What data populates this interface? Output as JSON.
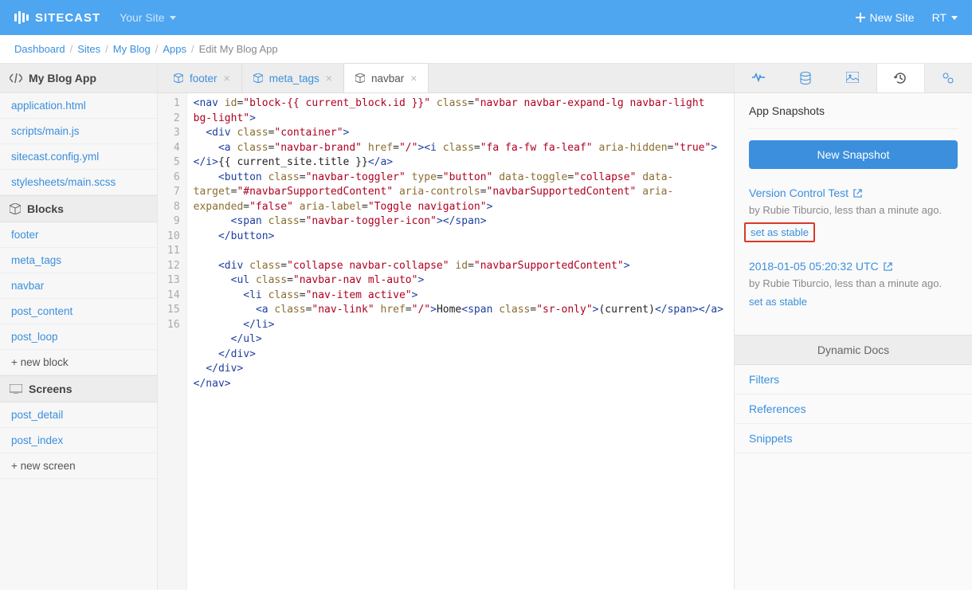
{
  "brand": "SITECAST",
  "site_selector": "Your Site",
  "topbar": {
    "new_site": "New Site",
    "user": "RT"
  },
  "breadcrumbs": [
    "Dashboard",
    "Sites",
    "My Blog",
    "Apps",
    "Edit My Blog App"
  ],
  "sidebar": {
    "app_title": "My Blog App",
    "files": [
      "application.html",
      "scripts/main.js",
      "sitecast.config.yml",
      "stylesheets/main.scss"
    ],
    "blocks_title": "Blocks",
    "blocks": [
      "footer",
      "meta_tags",
      "navbar",
      "post_content",
      "post_loop"
    ],
    "new_block": "+ new block",
    "screens_title": "Screens",
    "screens": [
      "post_detail",
      "post_index"
    ],
    "new_screen": "+ new screen"
  },
  "tabs": [
    {
      "label": "footer",
      "active": false
    },
    {
      "label": "meta_tags",
      "active": false
    },
    {
      "label": "navbar",
      "active": true
    }
  ],
  "code_lines": [
    1,
    2,
    3,
    4,
    5,
    6,
    7,
    8,
    9,
    10,
    11,
    12,
    13,
    14,
    15,
    16
  ],
  "code_html": "<span class='t-tag'>&lt;nav</span> <span class='t-attr'>id</span>=<span class='t-str'>\"block-{{ current_block.id }}\"</span> <span class='t-attr'>class</span>=<span class='t-str'>\"navbar navbar-expand-lg navbar-light bg-light\"</span><span class='t-tag'>&gt;</span>\n  <span class='t-tag'>&lt;div</span> <span class='t-attr'>class</span>=<span class='t-str'>\"container\"</span><span class='t-tag'>&gt;</span>\n    <span class='t-tag'>&lt;a</span> <span class='t-attr'>class</span>=<span class='t-str'>\"navbar-brand\"</span> <span class='t-attr'>href</span>=<span class='t-str'>\"/\"</span><span class='t-tag'>&gt;&lt;i</span> <span class='t-attr'>class</span>=<span class='t-str'>\"fa fa-fw fa-leaf\"</span> <span class='t-attr'>aria-hidden</span>=<span class='t-str'>\"true\"</span><span class='t-tag'>&gt;&lt;/i&gt;</span><span class='t-txt'>{{ current_site.title }}</span><span class='t-tag'>&lt;/a&gt;</span>\n    <span class='t-tag'>&lt;button</span> <span class='t-attr'>class</span>=<span class='t-str'>\"navbar-toggler\"</span> <span class='t-attr'>type</span>=<span class='t-str'>\"button\"</span> <span class='t-attr'>data-toggle</span>=<span class='t-str'>\"collapse\"</span> <span class='t-attr'>data-target</span>=<span class='t-str'>\"#navbarSupportedContent\"</span> <span class='t-attr'>aria-controls</span>=<span class='t-str'>\"navbarSupportedContent\"</span> <span class='t-attr'>aria-expanded</span>=<span class='t-str'>\"false\"</span> <span class='t-attr'>aria-label</span>=<span class='t-str'>\"Toggle navigation\"</span><span class='t-tag'>&gt;</span>\n      <span class='t-tag'>&lt;span</span> <span class='t-attr'>class</span>=<span class='t-str'>\"navbar-toggler-icon\"</span><span class='t-tag'>&gt;&lt;/span&gt;</span>\n    <span class='t-tag'>&lt;/button&gt;</span>\n\n    <span class='t-tag'>&lt;div</span> <span class='t-attr'>class</span>=<span class='t-str'>\"collapse navbar-collapse\"</span> <span class='t-attr'>id</span>=<span class='t-str'>\"navbarSupportedContent\"</span><span class='t-tag'>&gt;</span>\n      <span class='t-tag'>&lt;ul</span> <span class='t-attr'>class</span>=<span class='t-str'>\"navbar-nav ml-auto\"</span><span class='t-tag'>&gt;</span>\n        <span class='t-tag'>&lt;li</span> <span class='t-attr'>class</span>=<span class='t-str'>\"nav-item active\"</span><span class='t-tag'>&gt;</span>\n          <span class='t-tag'>&lt;a</span> <span class='t-attr'>class</span>=<span class='t-str'>\"nav-link\"</span> <span class='t-attr'>href</span>=<span class='t-str'>\"/\"</span><span class='t-tag'>&gt;</span><span class='t-txt'>Home</span><span class='t-tag'>&lt;span</span> <span class='t-attr'>class</span>=<span class='t-str'>\"sr-only\"</span><span class='t-tag'>&gt;</span><span class='t-txt'>(current)</span><span class='t-tag'>&lt;/span&gt;&lt;/a&gt;</span>\n        <span class='t-tag'>&lt;/li&gt;</span>\n      <span class='t-tag'>&lt;/ul&gt;</span>\n    <span class='t-tag'>&lt;/div&gt;</span>\n  <span class='t-tag'>&lt;/div&gt;</span>\n<span class='t-tag'>&lt;/nav&gt;</span>",
  "rightpanel": {
    "title": "App Snapshots",
    "new_snapshot": "New Snapshot",
    "snapshots": [
      {
        "title": "Version Control Test",
        "by": "by Rubie Tiburcio, less than a minute ago.",
        "action": "set as stable",
        "highlighted": true
      },
      {
        "title": "2018-01-05 05:20:32 UTC",
        "by": "by Rubie Tiburcio, less than a minute ago.",
        "action": "set as stable",
        "highlighted": false
      }
    ],
    "docs_header": "Dynamic Docs",
    "docs": [
      "Filters",
      "References",
      "Snippets"
    ]
  }
}
